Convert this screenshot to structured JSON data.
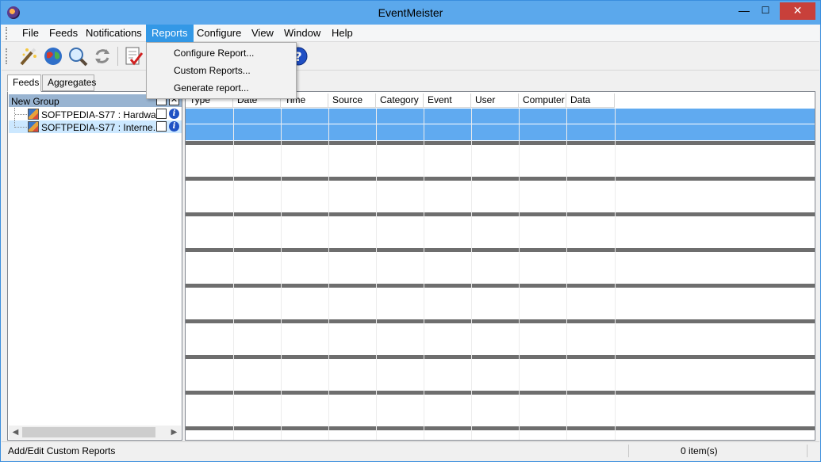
{
  "window": {
    "title": "EventMeister",
    "controls": {
      "minimize": "—",
      "maximize": "☐",
      "close": "✕"
    }
  },
  "menubar": {
    "items": [
      "File",
      "Feeds",
      "Notifications",
      "Reports",
      "Configure",
      "View",
      "Window",
      "Help"
    ],
    "active": "Reports"
  },
  "reports_menu": {
    "items": [
      "Configure Report...",
      "Custom Reports...",
      "Generate report..."
    ]
  },
  "toolbar": {
    "buttons": [
      "wand-icon",
      "globe-icon",
      "search-icon",
      "refresh-icon",
      "checklist-icon",
      "help-icon"
    ]
  },
  "left_tabs": [
    "Feeds",
    "Aggregates"
  ],
  "tree": {
    "group_label": "New Group",
    "feeds": [
      {
        "label": "SOFTPEDIA-S77 : Hardwa..."
      },
      {
        "label": "SOFTPEDIA-S77 : Interne..."
      }
    ]
  },
  "grid": {
    "columns": [
      "Type",
      "Date",
      "Time",
      "Source",
      "Category",
      "Event",
      "User",
      "Computer",
      "Data"
    ]
  },
  "statusbar": {
    "hint": "Add/Edit Custom Reports",
    "count": "0 item(s)"
  },
  "colors": {
    "accent": "#3398e6",
    "titlebar": "#5ba8ec",
    "selected_row": "#60aaf0",
    "band": "#6e6e6e",
    "close": "#c8403a"
  }
}
